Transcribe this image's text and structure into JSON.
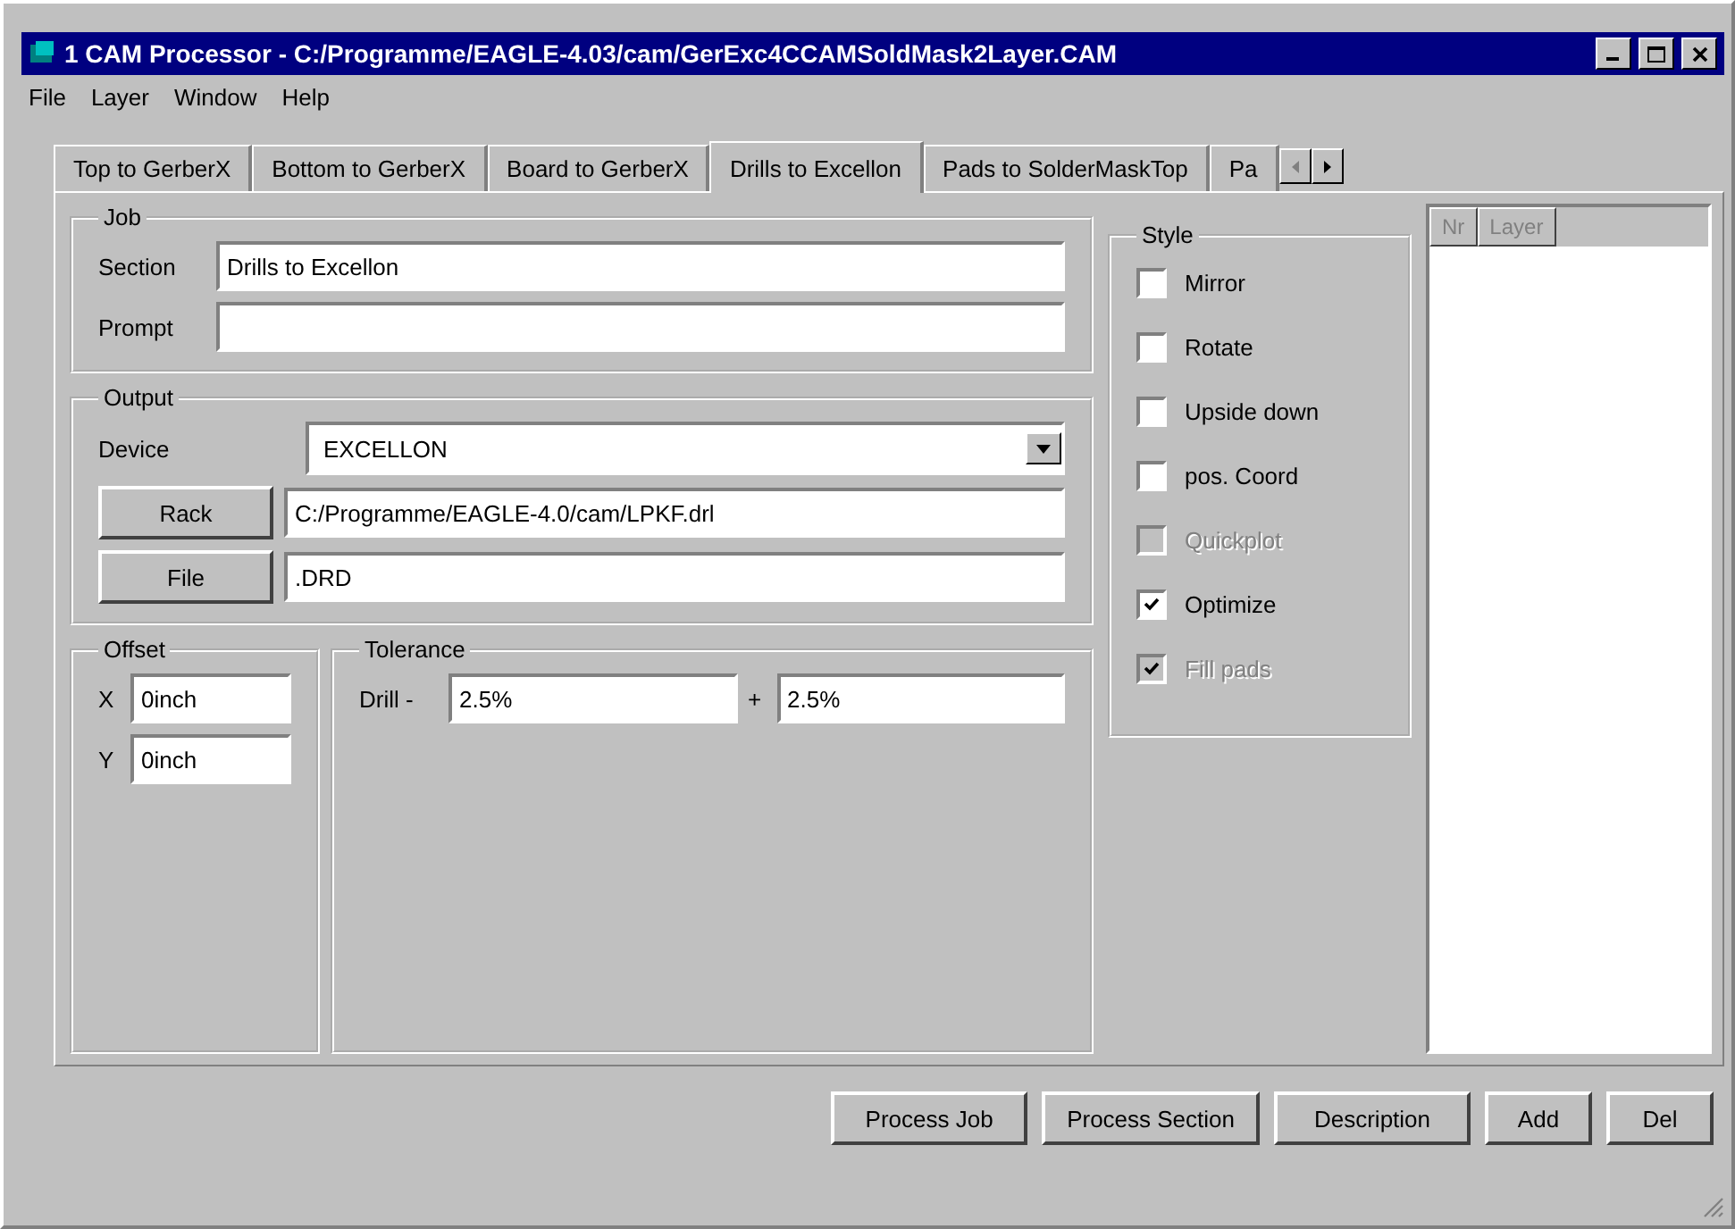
{
  "window": {
    "title": "1 CAM Processor - C:/Programme/EAGLE-4.03/cam/GerExc4CCAMSoldMask2Layer.CAM"
  },
  "menu": [
    "File",
    "Layer",
    "Window",
    "Help"
  ],
  "tabs": [
    {
      "label": "Top to GerberX",
      "selected": false
    },
    {
      "label": "Bottom to GerberX",
      "selected": false
    },
    {
      "label": "Board to GerberX",
      "selected": false
    },
    {
      "label": "Drills to Excellon",
      "selected": true
    },
    {
      "label": "Pads to SolderMaskTop",
      "selected": false
    },
    {
      "label": "Pa",
      "selected": false
    }
  ],
  "job": {
    "title": "Job",
    "section_label": "Section",
    "section_value": "Drills to Excellon",
    "prompt_label": "Prompt"
  },
  "output": {
    "title": "Output",
    "device_label": "Device",
    "device_value": "EXCELLON",
    "rack_button": "Rack",
    "rack_value": "C:/Programme/EAGLE-4.0/cam/LPKF.drl",
    "file_button": "File",
    "file_value": ".DRD"
  },
  "offset": {
    "title": "Offset",
    "x_label": "X",
    "x_value": "0inch",
    "y_label": "Y",
    "y_value": "0inch"
  },
  "tolerance": {
    "title": "Tolerance",
    "drill_label": "Drill -",
    "minus_value": "2.5%",
    "plus_label": "+",
    "plus_value": "2.5%"
  },
  "style": {
    "title": "Style",
    "options": [
      {
        "label": "Mirror",
        "checked": false,
        "disabled": false
      },
      {
        "label": "Rotate",
        "checked": false,
        "disabled": false
      },
      {
        "label": "Upside down",
        "checked": false,
        "disabled": false
      },
      {
        "label": "pos. Coord",
        "checked": false,
        "disabled": false
      },
      {
        "label": "Quickplot",
        "checked": false,
        "disabled": true
      },
      {
        "label": "Optimize",
        "checked": true,
        "disabled": false
      },
      {
        "label": "Fill pads",
        "checked": true,
        "disabled": true
      }
    ]
  },
  "layer_table": {
    "columns": [
      "Nr",
      "Layer"
    ]
  },
  "buttons": [
    "Process Job",
    "Process Section",
    "Description",
    "Add",
    "Del"
  ]
}
